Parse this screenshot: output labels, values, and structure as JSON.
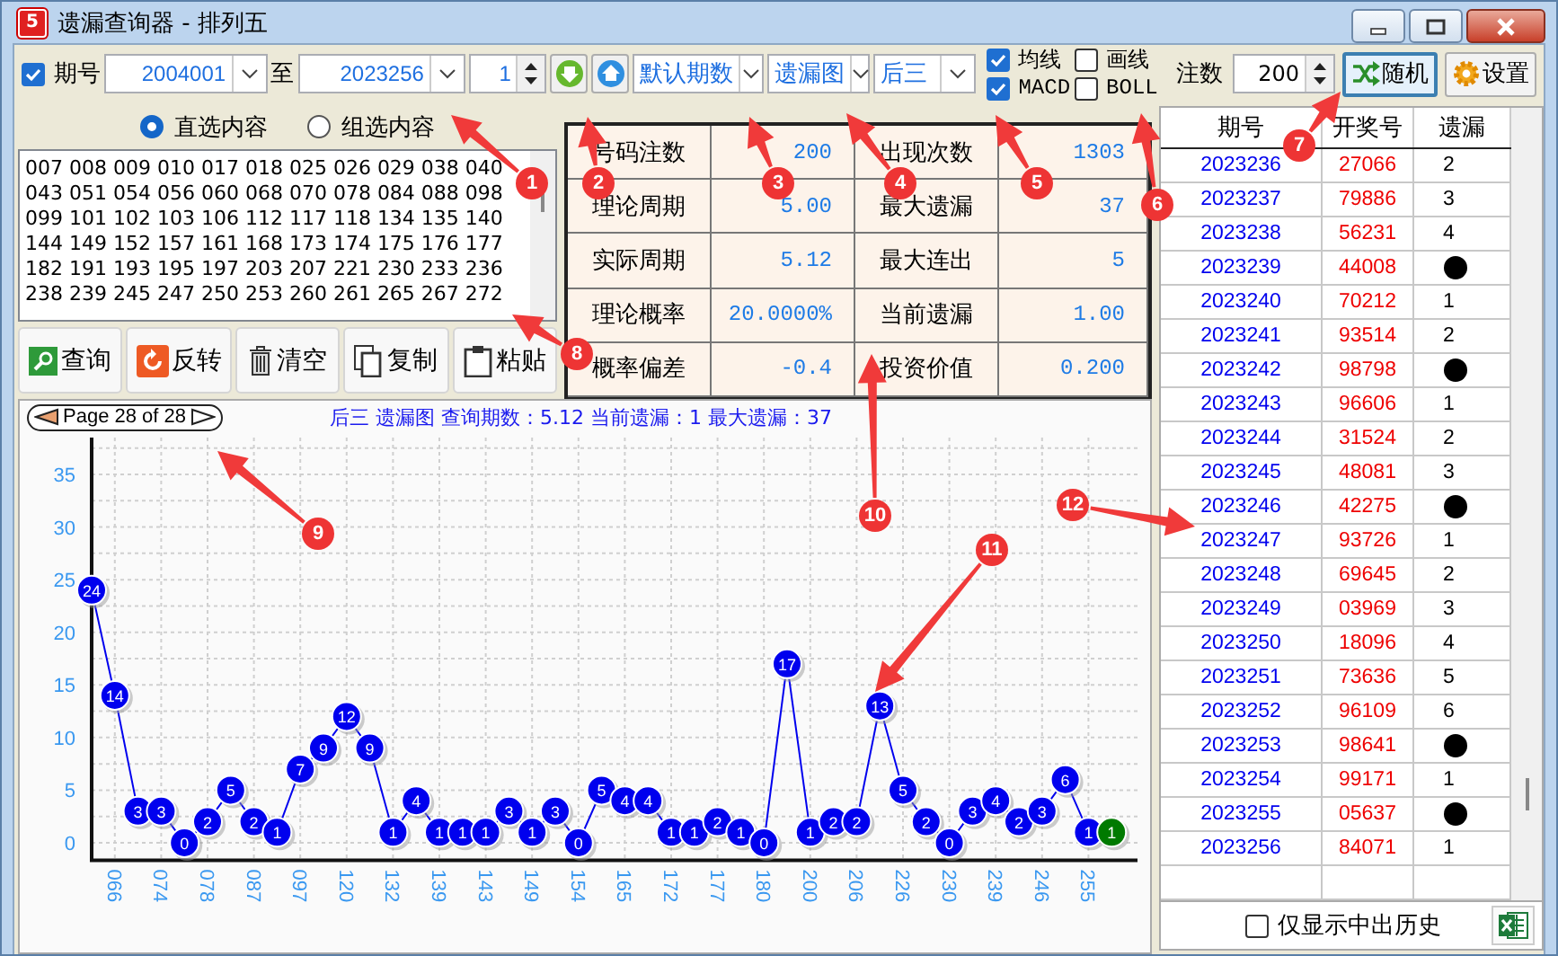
{
  "window": {
    "title": "遗漏查询器 - 排列五",
    "icon_label": "5"
  },
  "toolbar": {
    "period_check": {
      "label": "期号",
      "checked": true
    },
    "from": "2004001",
    "to_label": "至",
    "to": "2023256",
    "step": "1",
    "period_mode": "默认期数",
    "chart_kind": "遗漏图",
    "position": "后三",
    "overlays": [
      {
        "label": "均线",
        "checked": true
      },
      {
        "label": "画线",
        "checked": false
      },
      {
        "label": "MACD",
        "checked": true
      },
      {
        "label": "BOLL",
        "checked": false
      }
    ],
    "count_label": "注数",
    "count": "200",
    "buttons": [
      {
        "label": "随机",
        "kind": "shuffle",
        "focused": true
      },
      {
        "label": "设置",
        "kind": "gear",
        "focused": false
      }
    ]
  },
  "select_mode": [
    {
      "label": "直选内容",
      "selected": true
    },
    {
      "label": "组选内容",
      "selected": false
    }
  ],
  "numbers": [
    "007 008 009 010 017 018 025 026 029 038 040",
    "043 051 054 056 060 068 070 078 084 088 098",
    "099 101 102 103 106 112 117 118 134 135 140",
    "144 149 152 157 161 168 173 174 175 176 177",
    "182 191 193 195 197 203 207 221 230 233 236",
    "238 239 245 247 250 253 260 261 265 267 272"
  ],
  "actions": [
    {
      "label": "查询",
      "kind": "search"
    },
    {
      "label": "反转",
      "kind": "reverse"
    },
    {
      "label": "清空",
      "kind": "trash"
    },
    {
      "label": "复制",
      "kind": "copy"
    },
    {
      "label": "粘贴",
      "kind": "paste"
    }
  ],
  "stats": [
    [
      {
        "label": "号码注数",
        "value": "200"
      },
      {
        "label": "出现次数",
        "value": "1303"
      }
    ],
    [
      {
        "label": "理论周期",
        "value": "5.00"
      },
      {
        "label": "最大遗漏",
        "value": "37"
      }
    ],
    [
      {
        "label": "实际周期",
        "value": "5.12"
      },
      {
        "label": "最大连出",
        "value": "5"
      }
    ],
    [
      {
        "label": "理论概率",
        "value": "20.0000%"
      },
      {
        "label": "当前遗漏",
        "value": "1.00"
      }
    ],
    [
      {
        "label": "概率偏差",
        "value": "-0.4"
      },
      {
        "label": "投资价值",
        "value": "0.200"
      }
    ]
  ],
  "chart": {
    "page": "Page 28 of 28",
    "chart_data": {
      "type": "line",
      "title": "后三 遗漏图 查询期数：5.12 当前遗漏：1 最大遗漏：37",
      "categories": [
        null,
        "066",
        null,
        "074",
        null,
        "078",
        null,
        "087",
        null,
        "097",
        null,
        "120",
        null,
        "132",
        null,
        "139",
        null,
        "143",
        null,
        "149",
        null,
        "154",
        null,
        "165",
        null,
        "172",
        null,
        "177",
        null,
        "180",
        null,
        "200",
        null,
        "206",
        null,
        "226",
        null,
        "230",
        null,
        "239",
        null,
        "246",
        null,
        "255",
        null
      ],
      "yticks": [
        0,
        5,
        10,
        15,
        20,
        25,
        30,
        35
      ],
      "ylim": [
        -1.5,
        38.5
      ],
      "grid": true,
      "series": [
        {
          "color": "#0000ee",
          "marker": "circle",
          "values": [
            24,
            14,
            3,
            3,
            0,
            2,
            5,
            2,
            1,
            7,
            9,
            12,
            9,
            1,
            4,
            1,
            1,
            1,
            3,
            1,
            3,
            0,
            5,
            4,
            4,
            1,
            1,
            2,
            1,
            0,
            17,
            1,
            2,
            2,
            13,
            5,
            2,
            0,
            3,
            4,
            2,
            3,
            6,
            1,
            1
          ],
          "value_labels": [
            "24",
            "14",
            "3",
            "3",
            "0",
            "2",
            "5",
            "2",
            "1",
            "7",
            "9",
            "12",
            "9",
            "1",
            "4",
            "1",
            "1",
            "1",
            "3",
            "1",
            "3",
            "0",
            "5",
            "4",
            "4",
            "1",
            "1",
            "2",
            "1",
            "0",
            "17",
            "1",
            "2",
            "2",
            "13",
            "5",
            "2",
            "0",
            "3",
            "4",
            "2",
            "3",
            "6",
            "1",
            null
          ]
        },
        {
          "color": "#007a00",
          "marker": "circle",
          "values": [
            null,
            null,
            null,
            null,
            null,
            null,
            null,
            null,
            null,
            null,
            null,
            null,
            null,
            null,
            null,
            null,
            null,
            null,
            null,
            null,
            null,
            null,
            null,
            null,
            null,
            null,
            null,
            null,
            null,
            null,
            null,
            null,
            null,
            null,
            null,
            null,
            null,
            null,
            null,
            null,
            null,
            null,
            null,
            null,
            1
          ],
          "value_labels": [
            null,
            null,
            null,
            null,
            null,
            null,
            null,
            null,
            null,
            null,
            null,
            null,
            null,
            null,
            null,
            null,
            null,
            null,
            null,
            null,
            null,
            null,
            null,
            null,
            null,
            null,
            null,
            null,
            null,
            null,
            null,
            null,
            null,
            null,
            null,
            null,
            null,
            null,
            null,
            null,
            null,
            null,
            null,
            null,
            "1"
          ]
        }
      ]
    }
  },
  "history": {
    "columns": [
      "期号",
      "开奖号",
      "遗漏"
    ],
    "rows": [
      {
        "issue": "2023236",
        "number": "27066",
        "miss": "2",
        "hit": false
      },
      {
        "issue": "2023237",
        "number": "79886",
        "miss": "3",
        "hit": false
      },
      {
        "issue": "2023238",
        "number": "56231",
        "miss": "4",
        "hit": false
      },
      {
        "issue": "2023239",
        "number": "44008",
        "hit": true
      },
      {
        "issue": "2023240",
        "number": "70212",
        "miss": "1",
        "hit": false
      },
      {
        "issue": "2023241",
        "number": "93514",
        "miss": "2",
        "hit": false
      },
      {
        "issue": "2023242",
        "number": "98798",
        "hit": true
      },
      {
        "issue": "2023243",
        "number": "96606",
        "miss": "1",
        "hit": false
      },
      {
        "issue": "2023244",
        "number": "31524",
        "miss": "2",
        "hit": false
      },
      {
        "issue": "2023245",
        "number": "48081",
        "miss": "3",
        "hit": false
      },
      {
        "issue": "2023246",
        "number": "42275",
        "hit": true
      },
      {
        "issue": "2023247",
        "number": "93726",
        "miss": "1",
        "hit": false
      },
      {
        "issue": "2023248",
        "number": "69645",
        "miss": "2",
        "hit": false
      },
      {
        "issue": "2023249",
        "number": "03969",
        "miss": "3",
        "hit": false
      },
      {
        "issue": "2023250",
        "number": "18096",
        "miss": "4",
        "hit": false
      },
      {
        "issue": "2023251",
        "number": "73636",
        "miss": "5",
        "hit": false
      },
      {
        "issue": "2023252",
        "number": "96109",
        "miss": "6",
        "hit": false
      },
      {
        "issue": "2023253",
        "number": "98641",
        "hit": true
      },
      {
        "issue": "2023254",
        "number": "99171",
        "miss": "1",
        "hit": false
      },
      {
        "issue": "2023255",
        "number": "05637",
        "hit": true
      },
      {
        "issue": "2023256",
        "number": "84071",
        "miss": "1",
        "hit": false
      }
    ],
    "filter": {
      "label": "仅显示中出历史",
      "checked": false
    }
  },
  "callouts": [
    "1",
    "2",
    "3",
    "4",
    "5",
    "6",
    "7",
    "8",
    "9",
    "10",
    "11",
    "12"
  ]
}
